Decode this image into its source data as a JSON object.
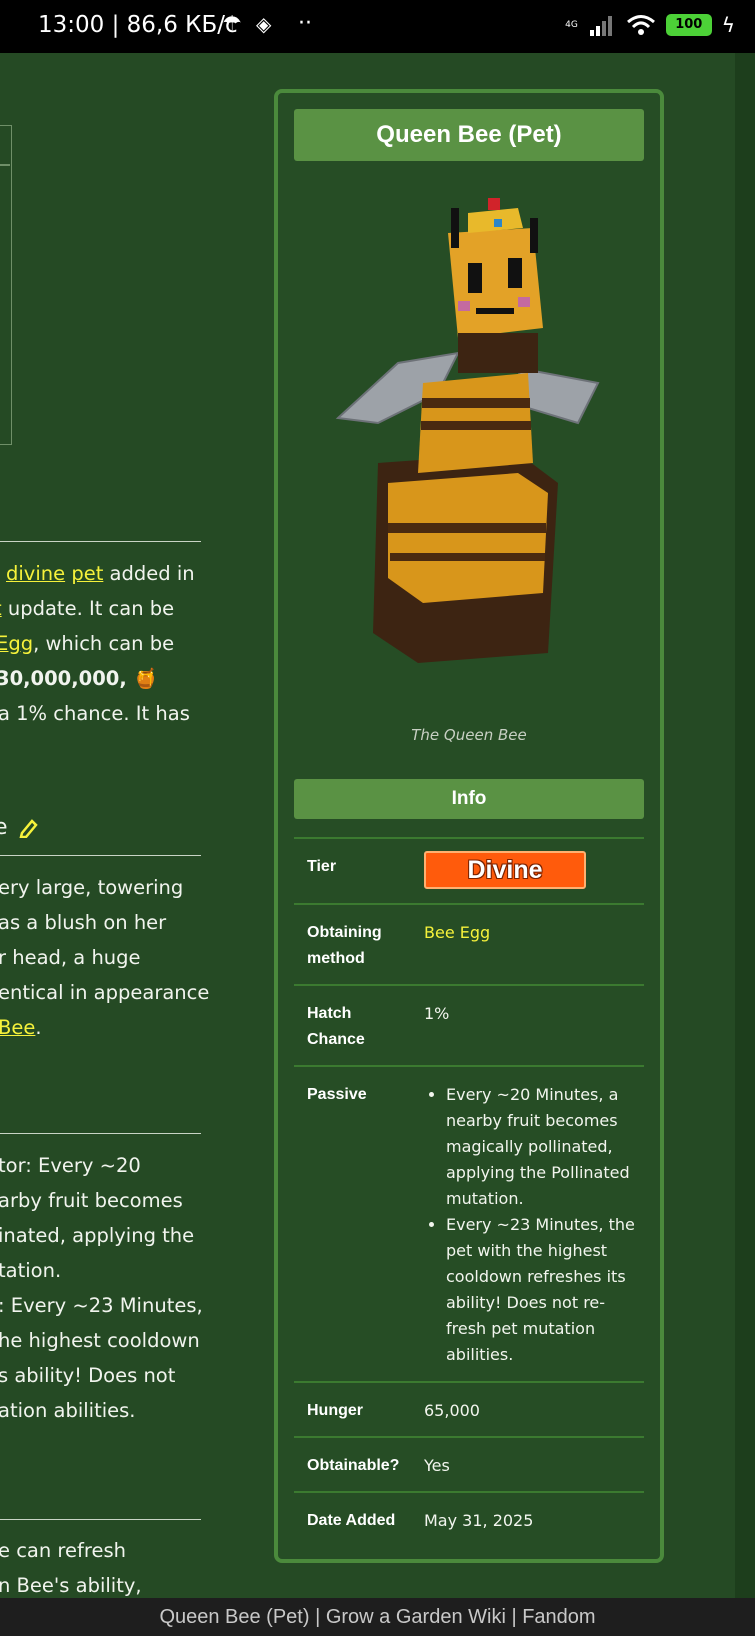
{
  "status_bar": {
    "time": "13:00 | 86,6 КБ/с",
    "network": "4G",
    "battery": "100"
  },
  "article": {
    "para1": [
      "divine",
      "pet",
      "added in",
      "update. It can be",
      "Egg",
      ", which can be",
      "30,000,000",
      "a 1% chance. It has"
    ],
    "para2": [
      "ery large, towering",
      "as a blush on her",
      "r head, a huge",
      "entical in appearance",
      "Bee"
    ],
    "para3": [
      "tor: Every ~20",
      "arby fruit becomes",
      "inated, applying the",
      "tation.",
      ": Every ~23 Minutes,",
      "he highest cooldown",
      "s ability! Does not",
      "ation abilities."
    ],
    "para4": [
      "e can refresh",
      "n Bee's ability,"
    ]
  },
  "infobox": {
    "title": "Queen Bee (Pet)",
    "caption": "The Queen Bee",
    "section": "Info",
    "rows": {
      "tier": {
        "label": "Tier",
        "value": "Divine"
      },
      "obtaining": {
        "label": "Obtaining method",
        "value": "Bee Egg"
      },
      "hatch": {
        "label": "Hatch Chance",
        "value": "1%"
      },
      "passive": {
        "label": "Passive",
        "items": [
          "Every ~20 Minutes, a nearby fruit becomes magically pollinated, applying the Pollinated mutation.",
          "Every ~23 Minutes, the pet with the highest cooldown refreshes its ability! Does not re-fresh pet mutation abilities."
        ]
      },
      "hunger": {
        "label": "Hunger",
        "value": "65,000"
      },
      "obtainable": {
        "label": "Obtainable?",
        "value": "Yes"
      },
      "date": {
        "label": "Date Added",
        "value": "May 31, 2025"
      }
    }
  },
  "url_bar": {
    "title": "Queen Bee (Pet) | Grow a Garden Wiki | Fandom"
  },
  "colors": {
    "background": "#254a24",
    "header_green": "#5a9244",
    "link_yellow": "#f6f23b",
    "divine_orange": "#ff5b0c"
  }
}
